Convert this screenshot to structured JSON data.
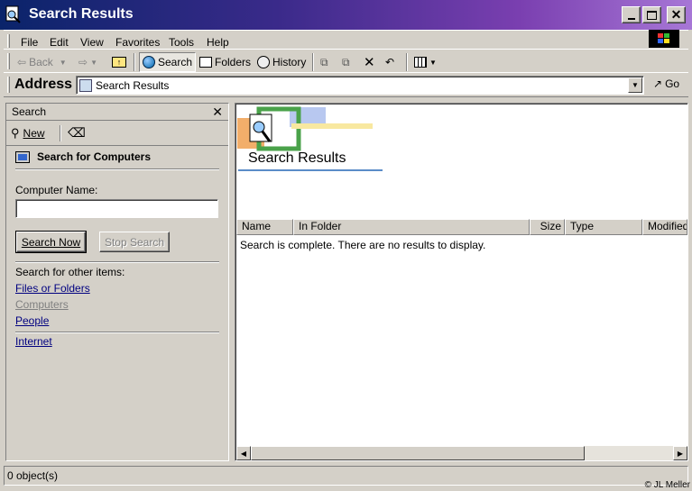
{
  "window": {
    "title": "Search Results"
  },
  "menu": [
    "File",
    "Edit",
    "View",
    "Favorites",
    "Tools",
    "Help"
  ],
  "toolbar": {
    "back": "Back",
    "search": "Search",
    "folders": "Folders",
    "history": "History"
  },
  "address": {
    "label": "Address",
    "value": "Search Results",
    "go": "Go"
  },
  "search_pane": {
    "title": "Search",
    "new_label": "New",
    "heading": "Search for Computers",
    "field_label": "Computer Name:",
    "field_value": "",
    "search_now": "Search Now",
    "stop_search": "Stop Search",
    "other_label": "Search for other items:",
    "links": {
      "files": "Files or Folders",
      "computers": "Computers",
      "people": "People",
      "internet": "Internet"
    }
  },
  "results": {
    "banner_title": "Search Results",
    "columns": [
      "Name",
      "In Folder",
      "Size",
      "Type",
      "Modified"
    ],
    "message": "Search is complete. There are no results to display."
  },
  "status": {
    "text": "0 object(s)"
  },
  "copyright": "© JL Meller",
  "colors": {
    "title_start": "#0a246a",
    "title_end": "#a777d6",
    "link": "#000080"
  }
}
